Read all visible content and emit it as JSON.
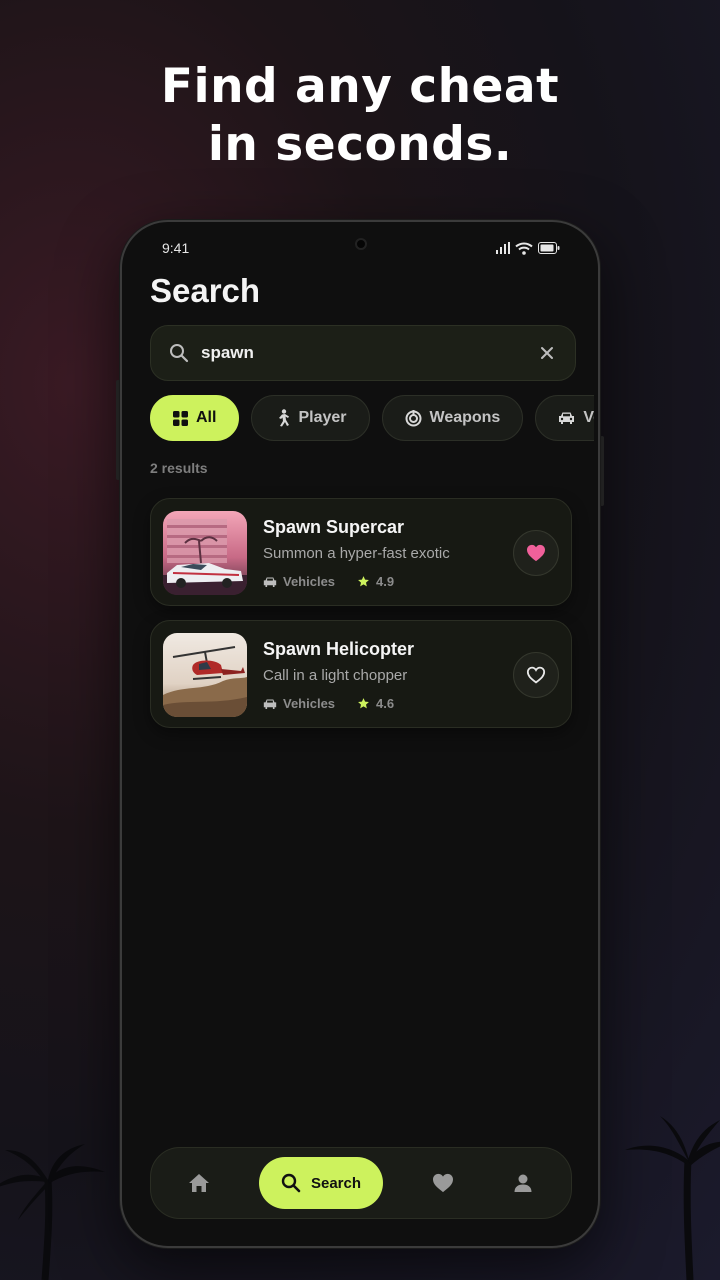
{
  "headline": {
    "line1": "Find any cheat",
    "line2": "in seconds."
  },
  "status_bar": {
    "time": "9:41"
  },
  "screen": {
    "title": "Search"
  },
  "search": {
    "value": "spawn",
    "placeholder": ""
  },
  "filters": [
    {
      "label": "All",
      "icon": "grid-icon",
      "active": true
    },
    {
      "label": "Player",
      "icon": "running-person-icon",
      "active": false
    },
    {
      "label": "Weapons",
      "icon": "target-icon",
      "active": false
    },
    {
      "label": "Vehicles",
      "icon": "car-icon",
      "active": false
    }
  ],
  "results": {
    "count_text": "2 results",
    "items": [
      {
        "title": "Spawn Supercar",
        "description": "Summon a hyper-fast exotic",
        "category": "Vehicles",
        "rating": "4.9",
        "favorited": true
      },
      {
        "title": "Spawn Helicopter",
        "description": "Call in a light chopper",
        "category": "Vehicles",
        "rating": "4.6",
        "favorited": false
      }
    ]
  },
  "bottom_nav": {
    "search_label": "Search"
  },
  "colors": {
    "accent": "#cdf25d",
    "favorite": "#f0609a",
    "background": "#0f0f0f",
    "card": "#171913"
  }
}
